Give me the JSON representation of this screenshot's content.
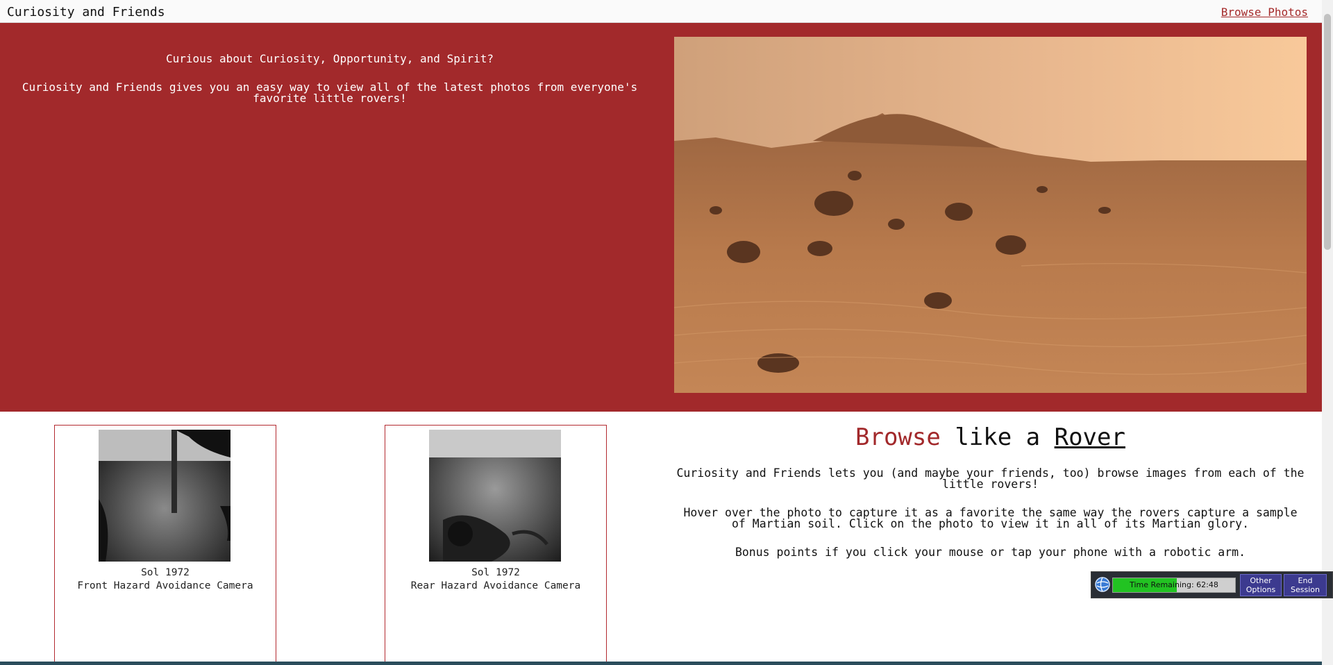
{
  "navbar": {
    "brand": "Curiosity and Friends",
    "browse_link": "Browse Photos"
  },
  "hero": {
    "heading": "Curious about Curiosity, Opportunity, and Spirit?",
    "description": "Curiosity and Friends gives you an easy way to view all of the latest photos from everyone's favorite little rovers!",
    "image": "mars-landscape-photo"
  },
  "cards": [
    {
      "sol": "Sol 1972",
      "camera": "Front Hazard Avoidance Camera",
      "image": "front-hazcam-photo"
    },
    {
      "sol": "Sol 1972",
      "camera": "Rear Hazard Avoidance Camera",
      "image": "rear-hazcam-photo"
    }
  ],
  "browse": {
    "heading_word1": "Browse",
    "heading_word2": " like a ",
    "heading_word3": "Rover",
    "p1": "Curiosity and Friends lets you (and maybe your friends, too) browse images from each of the little rovers!",
    "p2": "Hover over the photo to capture it as a favorite the same way the rovers capture a sample of Martian soil. Click on the photo to view it in all of its Martian glory.",
    "p3": "Bonus points if you click your mouse or tap your phone with a robotic arm."
  },
  "session": {
    "timer_label": "Time Remaining: 62:48",
    "timer_fraction": 0.52,
    "other_options": "Other Options",
    "end_session": "End Session",
    "icon": "session-globe-icon"
  },
  "colors": {
    "hero_bg": "#a2292b",
    "accent": "#a52a2a",
    "timer_green": "#22c322",
    "session_button": "#3c3a8f"
  }
}
